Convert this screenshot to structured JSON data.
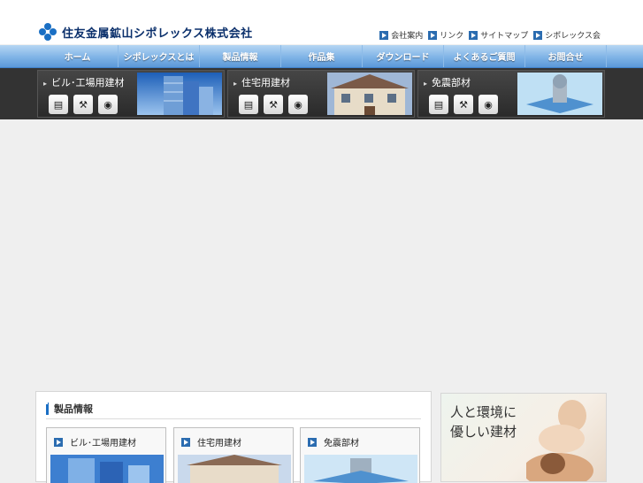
{
  "header": {
    "company_name": "住友金属鉱山シポレックス株式会社",
    "util_links": [
      "会社案内",
      "リンク",
      "サイトマップ",
      "シポレックス会"
    ]
  },
  "nav": {
    "items": [
      "ホーム",
      "シポレックスとは",
      "製品情報",
      "作品集",
      "ダウンロード",
      "よくあるご質問",
      "お問合せ"
    ]
  },
  "categories": [
    {
      "title": "ビル･工場用建材",
      "icons": [
        "document-icon",
        "hammer-icon",
        "camera-icon"
      ]
    },
    {
      "title": "住宅用建材",
      "icons": [
        "document-icon",
        "hammer-icon",
        "camera-icon"
      ]
    },
    {
      "title": "免震部材",
      "icons": [
        "document-icon",
        "hammer-icon",
        "camera-icon"
      ]
    }
  ],
  "products": {
    "heading": "製品情報",
    "cards": [
      "ビル･工場用建材",
      "住宅用建材",
      "免震部材"
    ]
  },
  "ad": {
    "line1": "人と環境に",
    "line2": "優しい建材"
  },
  "colors": {
    "accent": "#1a6fc4",
    "nav_bar": "#7fb3e6",
    "category_bar": "#333333",
    "background": "#efefef"
  }
}
